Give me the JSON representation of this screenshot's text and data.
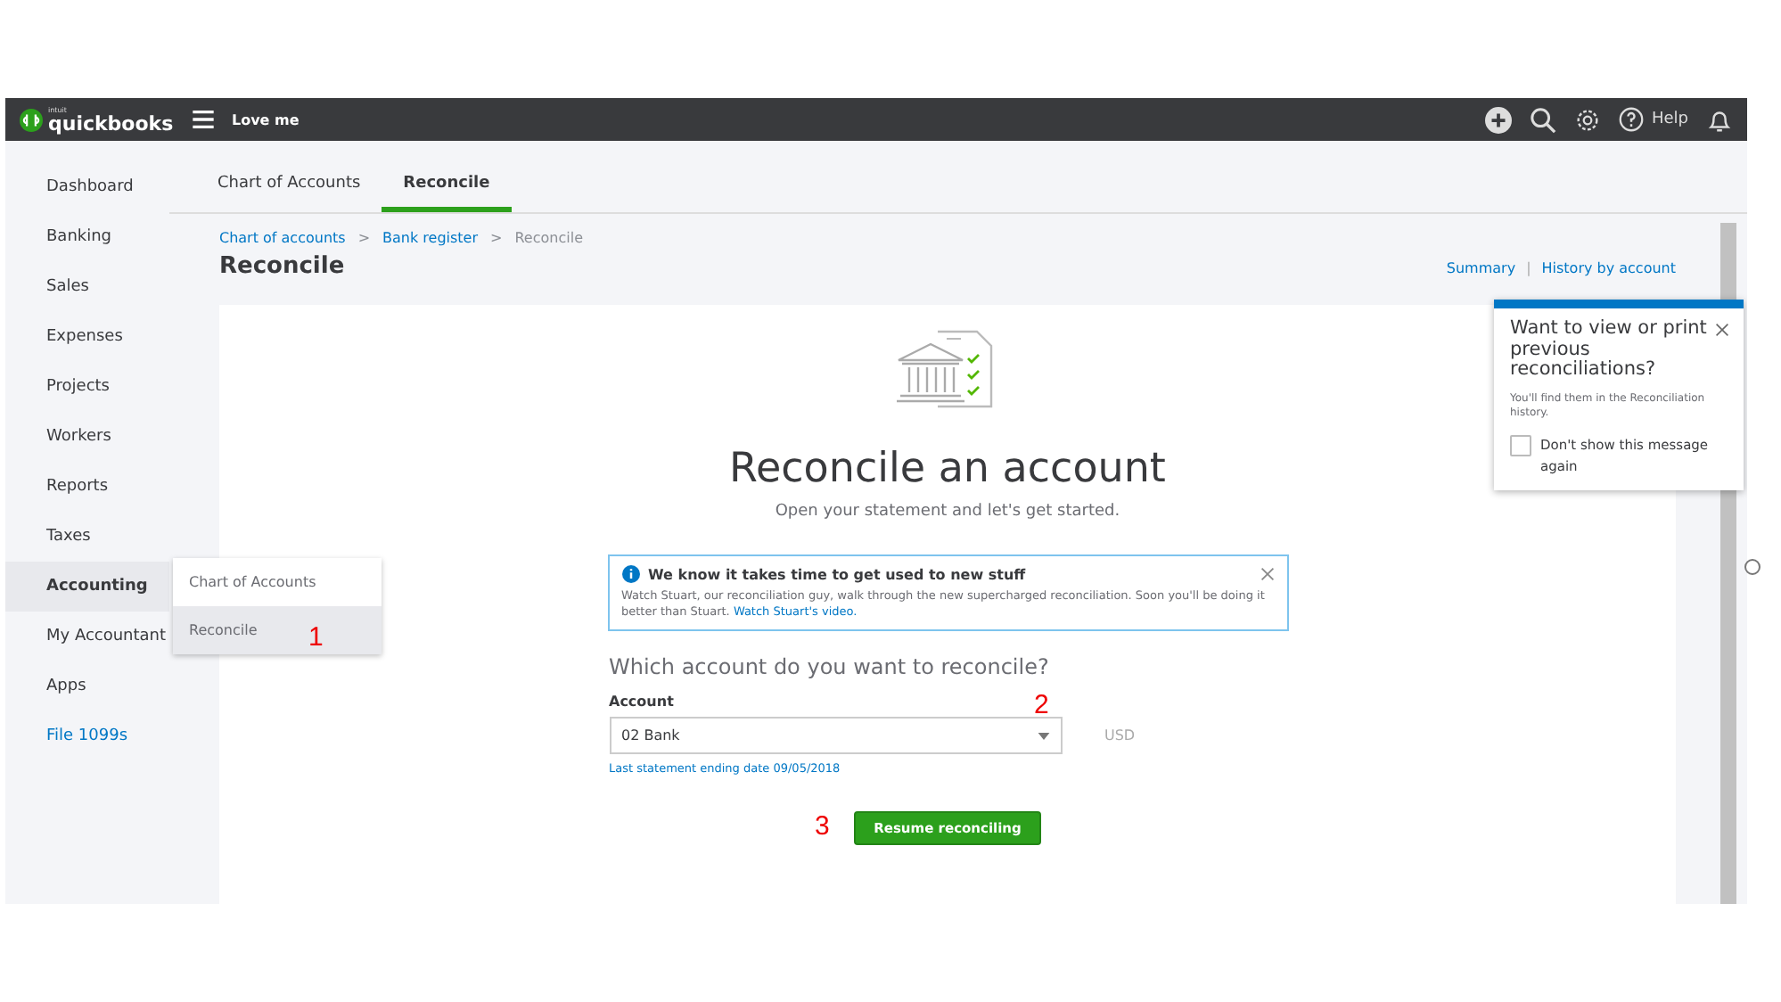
{
  "topbar": {
    "brand_small": "intuit",
    "brand": "quickbooks",
    "company": "Love me",
    "help": "Help"
  },
  "sidebar": {
    "items": [
      {
        "label": "Dashboard",
        "kind": "nav",
        "selected": false
      },
      {
        "label": "Banking",
        "kind": "nav",
        "selected": false
      },
      {
        "label": "Sales",
        "kind": "nav",
        "selected": false
      },
      {
        "label": "Expenses",
        "kind": "nav",
        "selected": false
      },
      {
        "label": "Projects",
        "kind": "nav",
        "selected": false
      },
      {
        "label": "Workers",
        "kind": "nav",
        "selected": false
      },
      {
        "label": "Reports",
        "kind": "nav",
        "selected": false
      },
      {
        "label": "Taxes",
        "kind": "nav",
        "selected": false
      },
      {
        "label": "Accounting",
        "kind": "nav",
        "selected": true
      },
      {
        "label": "My Accountant",
        "kind": "nav",
        "selected": false
      },
      {
        "label": "Apps",
        "kind": "nav",
        "selected": false
      },
      {
        "label": "File 1099s",
        "kind": "link",
        "selected": false
      }
    ]
  },
  "submenu": {
    "items": [
      {
        "label": "Chart of Accounts",
        "selected": false
      },
      {
        "label": "Reconcile",
        "selected": true
      }
    ]
  },
  "tabs": [
    {
      "label": "Chart of Accounts",
      "selected": false
    },
    {
      "label": "Reconcile",
      "selected": true
    }
  ],
  "breadcrumb": {
    "separator": ">",
    "items": [
      {
        "label": "Chart of accounts",
        "kind": "link"
      },
      {
        "label": "Bank register",
        "kind": "link"
      },
      {
        "label": "Reconcile",
        "kind": "current"
      }
    ]
  },
  "page_title": "Reconcile",
  "header_links": {
    "separator": "|",
    "items": [
      "Summary",
      "History by account"
    ]
  },
  "popover": {
    "title": "Want to view or print previous reconciliations?",
    "body": "You'll find them in the Reconciliation history.",
    "checkbox": {
      "label": "Don't show this message again",
      "checked": false
    }
  },
  "hero": {
    "title": "Reconcile an account",
    "subtitle": "Open your statement and let's get started."
  },
  "notice": {
    "title": "We know it takes time to get used to new stuff",
    "body": "Watch Stuart, our reconciliation guy, walk through the new supercharged reconciliation. Soon you'll be doing it better than Stuart.",
    "link": "Watch Stuart's video."
  },
  "question": "Which account do you want to reconcile?",
  "account": {
    "label": "Account",
    "value": "02 Bank",
    "currency": "USD",
    "last_statement": "Last statement ending date 09/05/2018"
  },
  "button": "Resume reconciling",
  "annotations": [
    {
      "label": "1"
    },
    {
      "label": "2"
    },
    {
      "label": "3"
    }
  ]
}
